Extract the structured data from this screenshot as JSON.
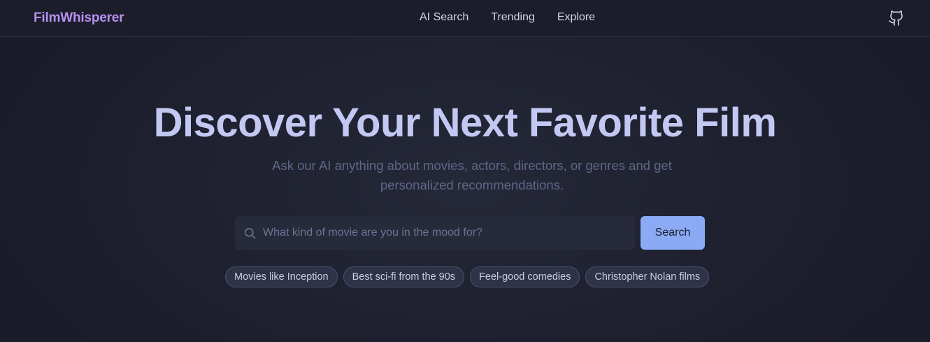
{
  "nav": {
    "brand": "FilmWhisperer",
    "links": [
      "AI Search",
      "Trending",
      "Explore"
    ],
    "github_icon": "github-icon"
  },
  "hero": {
    "title": "Discover Your Next Favorite Film",
    "subtitle": "Ask our AI anything about movies, actors, directors, or genres and get personalized recommendations."
  },
  "search": {
    "placeholder": "What kind of movie are you in the mood for?",
    "value": "",
    "button_label": "Search",
    "icon": "search-icon"
  },
  "suggestions": [
    "Movies like Inception",
    "Best sci-fi from the 90s",
    "Feel-good comedies",
    "Christopher Nolan films"
  ],
  "colors": {
    "background": "#1e1f2e",
    "brand": "#b690f0",
    "title": "#c3c8f3",
    "accent_button": "#8aaaf5"
  }
}
